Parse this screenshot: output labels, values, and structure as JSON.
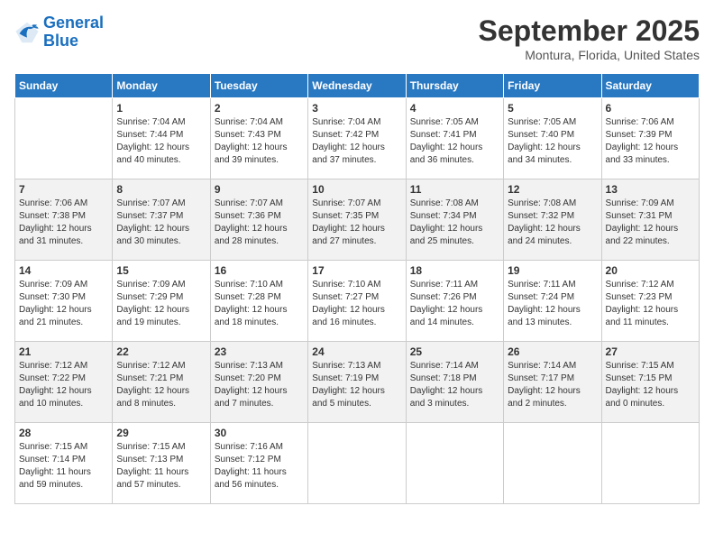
{
  "logo": {
    "line1": "General",
    "line2": "Blue"
  },
  "title": "September 2025",
  "subtitle": "Montura, Florida, United States",
  "days_of_week": [
    "Sunday",
    "Monday",
    "Tuesday",
    "Wednesday",
    "Thursday",
    "Friday",
    "Saturday"
  ],
  "weeks": [
    [
      {
        "day": "",
        "info": ""
      },
      {
        "day": "1",
        "info": "Sunrise: 7:04 AM\nSunset: 7:44 PM\nDaylight: 12 hours\nand 40 minutes."
      },
      {
        "day": "2",
        "info": "Sunrise: 7:04 AM\nSunset: 7:43 PM\nDaylight: 12 hours\nand 39 minutes."
      },
      {
        "day": "3",
        "info": "Sunrise: 7:04 AM\nSunset: 7:42 PM\nDaylight: 12 hours\nand 37 minutes."
      },
      {
        "day": "4",
        "info": "Sunrise: 7:05 AM\nSunset: 7:41 PM\nDaylight: 12 hours\nand 36 minutes."
      },
      {
        "day": "5",
        "info": "Sunrise: 7:05 AM\nSunset: 7:40 PM\nDaylight: 12 hours\nand 34 minutes."
      },
      {
        "day": "6",
        "info": "Sunrise: 7:06 AM\nSunset: 7:39 PM\nDaylight: 12 hours\nand 33 minutes."
      }
    ],
    [
      {
        "day": "7",
        "info": "Sunrise: 7:06 AM\nSunset: 7:38 PM\nDaylight: 12 hours\nand 31 minutes."
      },
      {
        "day": "8",
        "info": "Sunrise: 7:07 AM\nSunset: 7:37 PM\nDaylight: 12 hours\nand 30 minutes."
      },
      {
        "day": "9",
        "info": "Sunrise: 7:07 AM\nSunset: 7:36 PM\nDaylight: 12 hours\nand 28 minutes."
      },
      {
        "day": "10",
        "info": "Sunrise: 7:07 AM\nSunset: 7:35 PM\nDaylight: 12 hours\nand 27 minutes."
      },
      {
        "day": "11",
        "info": "Sunrise: 7:08 AM\nSunset: 7:34 PM\nDaylight: 12 hours\nand 25 minutes."
      },
      {
        "day": "12",
        "info": "Sunrise: 7:08 AM\nSunset: 7:32 PM\nDaylight: 12 hours\nand 24 minutes."
      },
      {
        "day": "13",
        "info": "Sunrise: 7:09 AM\nSunset: 7:31 PM\nDaylight: 12 hours\nand 22 minutes."
      }
    ],
    [
      {
        "day": "14",
        "info": "Sunrise: 7:09 AM\nSunset: 7:30 PM\nDaylight: 12 hours\nand 21 minutes."
      },
      {
        "day": "15",
        "info": "Sunrise: 7:09 AM\nSunset: 7:29 PM\nDaylight: 12 hours\nand 19 minutes."
      },
      {
        "day": "16",
        "info": "Sunrise: 7:10 AM\nSunset: 7:28 PM\nDaylight: 12 hours\nand 18 minutes."
      },
      {
        "day": "17",
        "info": "Sunrise: 7:10 AM\nSunset: 7:27 PM\nDaylight: 12 hours\nand 16 minutes."
      },
      {
        "day": "18",
        "info": "Sunrise: 7:11 AM\nSunset: 7:26 PM\nDaylight: 12 hours\nand 14 minutes."
      },
      {
        "day": "19",
        "info": "Sunrise: 7:11 AM\nSunset: 7:24 PM\nDaylight: 12 hours\nand 13 minutes."
      },
      {
        "day": "20",
        "info": "Sunrise: 7:12 AM\nSunset: 7:23 PM\nDaylight: 12 hours\nand 11 minutes."
      }
    ],
    [
      {
        "day": "21",
        "info": "Sunrise: 7:12 AM\nSunset: 7:22 PM\nDaylight: 12 hours\nand 10 minutes."
      },
      {
        "day": "22",
        "info": "Sunrise: 7:12 AM\nSunset: 7:21 PM\nDaylight: 12 hours\nand 8 minutes."
      },
      {
        "day": "23",
        "info": "Sunrise: 7:13 AM\nSunset: 7:20 PM\nDaylight: 12 hours\nand 7 minutes."
      },
      {
        "day": "24",
        "info": "Sunrise: 7:13 AM\nSunset: 7:19 PM\nDaylight: 12 hours\nand 5 minutes."
      },
      {
        "day": "25",
        "info": "Sunrise: 7:14 AM\nSunset: 7:18 PM\nDaylight: 12 hours\nand 3 minutes."
      },
      {
        "day": "26",
        "info": "Sunrise: 7:14 AM\nSunset: 7:17 PM\nDaylight: 12 hours\nand 2 minutes."
      },
      {
        "day": "27",
        "info": "Sunrise: 7:15 AM\nSunset: 7:15 PM\nDaylight: 12 hours\nand 0 minutes."
      }
    ],
    [
      {
        "day": "28",
        "info": "Sunrise: 7:15 AM\nSunset: 7:14 PM\nDaylight: 11 hours\nand 59 minutes."
      },
      {
        "day": "29",
        "info": "Sunrise: 7:15 AM\nSunset: 7:13 PM\nDaylight: 11 hours\nand 57 minutes."
      },
      {
        "day": "30",
        "info": "Sunrise: 7:16 AM\nSunset: 7:12 PM\nDaylight: 11 hours\nand 56 minutes."
      },
      {
        "day": "",
        "info": ""
      },
      {
        "day": "",
        "info": ""
      },
      {
        "day": "",
        "info": ""
      },
      {
        "day": "",
        "info": ""
      }
    ]
  ]
}
